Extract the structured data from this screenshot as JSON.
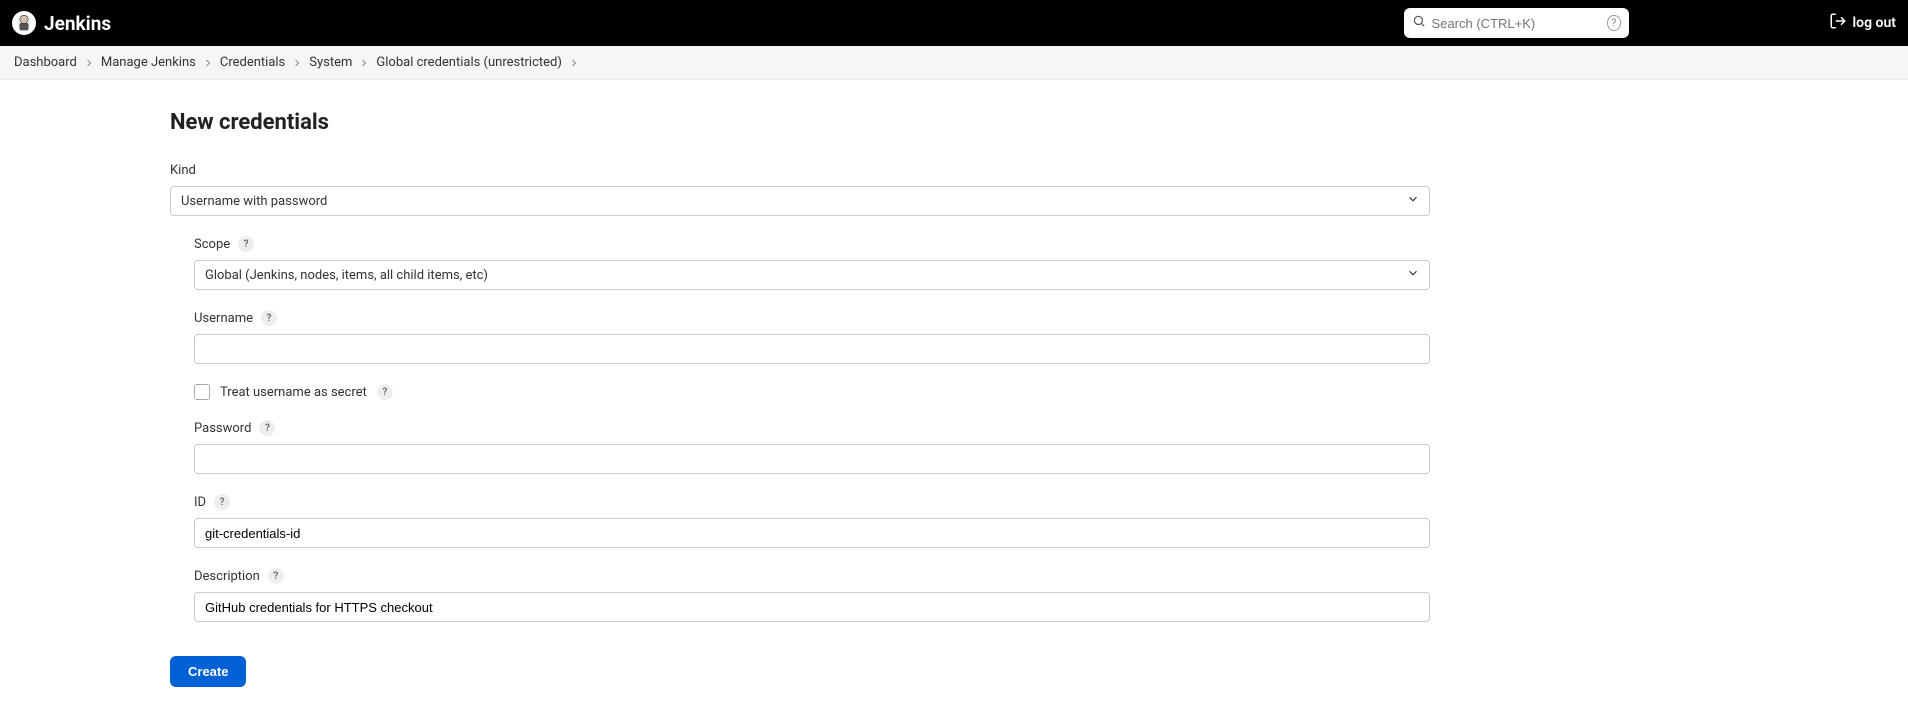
{
  "header": {
    "brand": "Jenkins",
    "search_placeholder": "Search (CTRL+K)",
    "logout_label": "log out"
  },
  "breadcrumb": {
    "items": [
      "Dashboard",
      "Manage Jenkins",
      "Credentials",
      "System",
      "Global credentials (unrestricted)"
    ]
  },
  "page": {
    "title": "New credentials"
  },
  "form": {
    "kind_label": "Kind",
    "kind_value": "Username with password",
    "scope_label": "Scope",
    "scope_value": "Global (Jenkins, nodes, items, all child items, etc)",
    "username_label": "Username",
    "username_value": "",
    "treat_secret_label": "Treat username as secret",
    "password_label": "Password",
    "password_value": "",
    "id_label": "ID",
    "id_value": "git-credentials-id",
    "description_label": "Description",
    "description_value": "GitHub credentials for HTTPS checkout",
    "create_label": "Create"
  }
}
